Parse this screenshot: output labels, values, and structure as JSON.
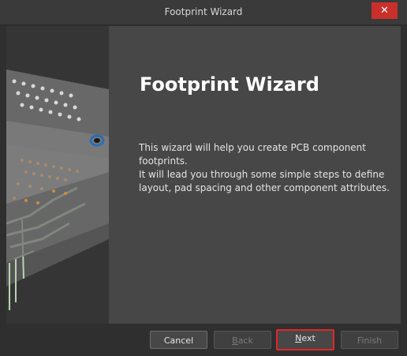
{
  "window": {
    "title": "Footprint Wizard",
    "close_symbol": "✕"
  },
  "main": {
    "heading": "Footprint Wizard",
    "description_line1": "This wizard will help you create PCB component footprints.",
    "description_line2": "It will lead you through some simple steps to define layout, pad spacing and other component attributes."
  },
  "footer": {
    "cancel": {
      "label": "Cancel",
      "enabled": true
    },
    "back": {
      "label_ul": "B",
      "label_rest": "ack",
      "enabled": false
    },
    "next": {
      "label_ul": "N",
      "label_rest": "ext",
      "enabled": true,
      "highlight_color": "#e32626"
    },
    "finish": {
      "label": "Finish",
      "enabled": false
    }
  },
  "icons": {
    "close": "close-icon",
    "side_image": "pcb-layers-illustration"
  }
}
